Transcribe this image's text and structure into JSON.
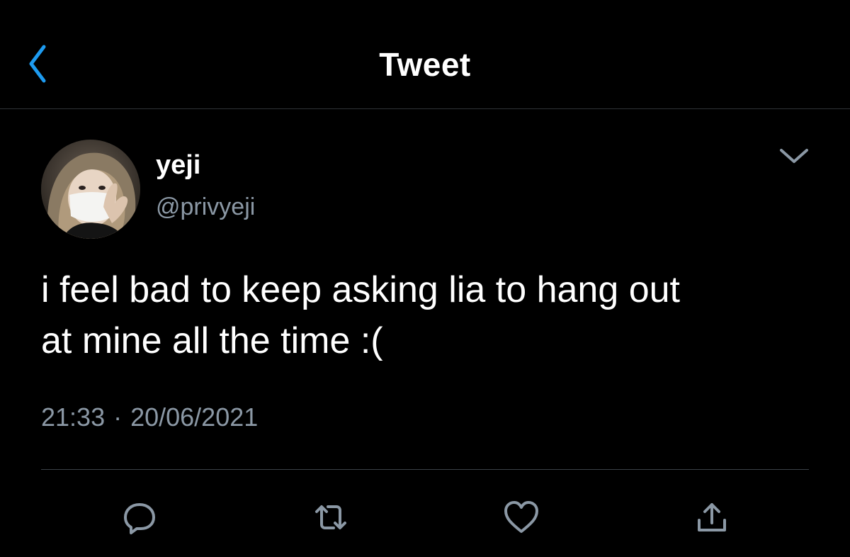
{
  "header": {
    "title": "Tweet",
    "back_icon": "chevron-left-icon"
  },
  "tweet": {
    "display_name": "yeji",
    "handle": "@privyeji",
    "text_line1": "i feel bad to keep asking lia to hang out",
    "text_line2": "at mine all the time :(",
    "time": "21:33",
    "separator": "·",
    "date": "20/06/2021",
    "more_icon": "chevron-down-icon"
  },
  "actions": {
    "reply_icon": "reply-icon",
    "retweet_icon": "retweet-icon",
    "like_icon": "heart-icon",
    "share_icon": "share-icon"
  },
  "colors": {
    "background": "#000000",
    "text": "#ffffff",
    "secondary": "#8b98a5",
    "accent": "#1d9bf0",
    "divider": "#2f3336"
  }
}
